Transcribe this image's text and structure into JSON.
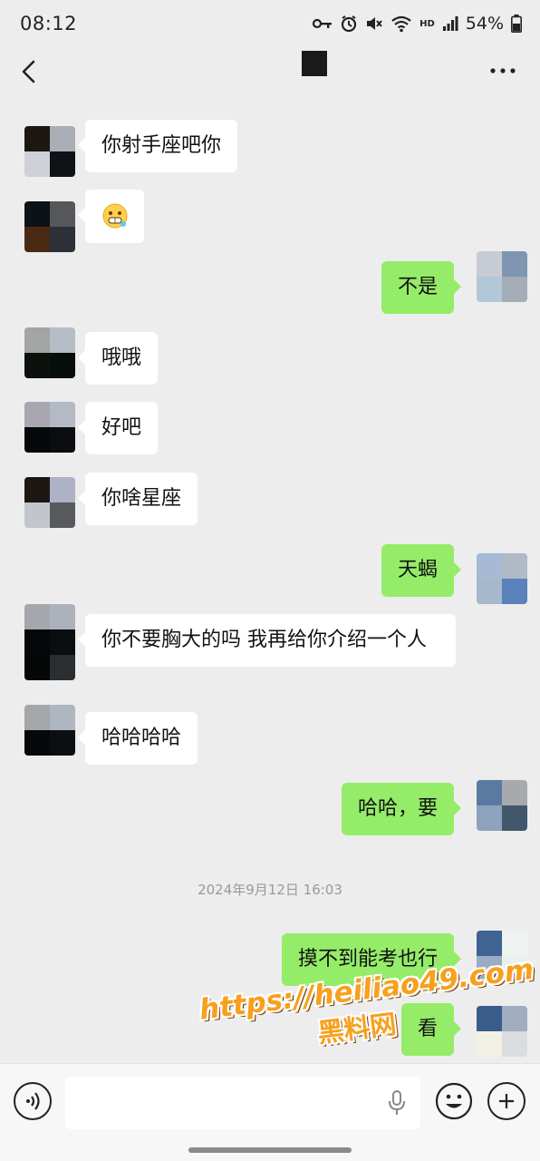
{
  "status_bar": {
    "time": "08:12",
    "hd_label": "HD",
    "battery": "54%"
  },
  "header": {
    "back_icon": "chevron-left-icon",
    "more_icon": "ellipsis-icon"
  },
  "messages": [
    {
      "side": "in",
      "text": "你射手座吧你",
      "avatar": [
        "#1d1712",
        "#a9adb6",
        "#cfd0d8",
        "#101315"
      ]
    },
    {
      "side": "in",
      "text": "",
      "emoji": "grimace-emoji-icon",
      "avatar": [
        "#0d1218",
        "#55575b",
        "#4a2a12",
        "#2c3038"
      ]
    },
    {
      "side": "out",
      "text": "不是",
      "avatar": [
        "#c7ccd4",
        "#7e96b1",
        "#b2c7d8",
        "#a3acb7"
      ]
    },
    {
      "side": "in",
      "text": "哦哦",
      "avatar": [
        "#a2a5a3",
        "#b5bcc6",
        "#0c110d",
        "#070d0b"
      ]
    },
    {
      "side": "in",
      "text": "好吧",
      "avatar": [
        "#a9a6b1",
        "#b3bac4",
        "#050808",
        "#0b0d10"
      ]
    },
    {
      "side": "in",
      "text": "你啥星座",
      "avatar": [
        "#1d1713",
        "#adb2c7",
        "#c3c5cc",
        "#58595c"
      ]
    },
    {
      "side": "out",
      "text": "天蝎",
      "avatar": [
        "#a6b9d5",
        "#b0bac7",
        "#a6b8cc",
        "#5a81b9"
      ]
    },
    {
      "side": "in",
      "text": "你不要胸大的吗 我再给你介绍一个人",
      "avatar": [
        "#a6a7ac",
        "#acb2bc",
        "#050808",
        "#0a0e10"
      ]
    },
    {
      "side": "in",
      "text": "哈哈哈哈",
      "avatar": [
        "#a5a6aa",
        "#aeb6c2",
        "#050909",
        "#0b0f11"
      ]
    },
    {
      "side": "out",
      "text": "哈哈，要",
      "avatar": [
        "#5b7aa2",
        "#a6aaad",
        "#8ea2bd",
        "#42576b"
      ]
    },
    {
      "side": "out",
      "text": "摸不到能考也行",
      "avatar": [
        "#3f6392",
        "#eff3ef",
        "#9aabc3",
        "#e9f1ef"
      ]
    },
    {
      "side": "out",
      "text": "看",
      "avatar": [
        "#3a5c8a",
        "#a0adc0",
        "#f3f0e6",
        "#d9dde0"
      ]
    }
  ],
  "timestamp": "2024年9月12日 16:03",
  "watermark": {
    "line1": "https://heiliao49.com",
    "line2": "黑料网"
  },
  "input_bar": {
    "voice_icon": "voice-icon",
    "mic_icon": "mic-icon",
    "emoji_icon": "smiley-icon",
    "plus_icon": "plus-icon"
  }
}
